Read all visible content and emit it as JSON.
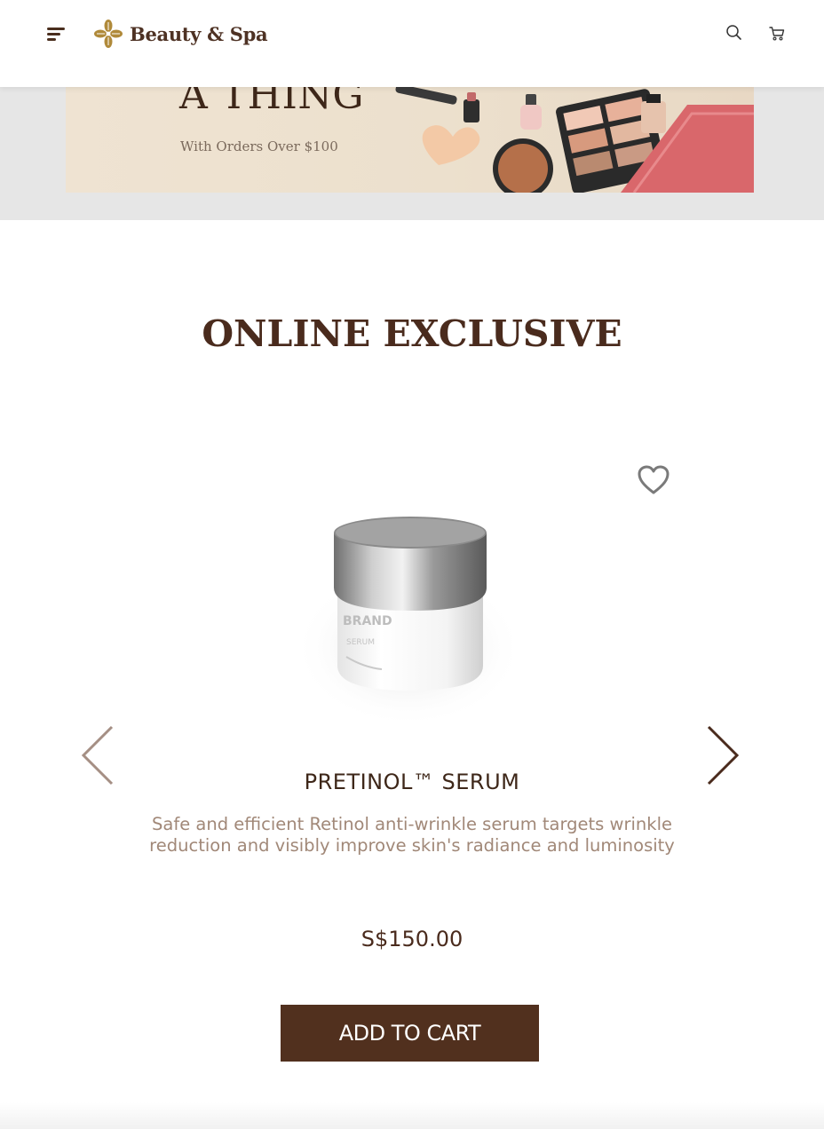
{
  "header": {
    "logo_text": "Beauty & Spa",
    "icons": [
      "menu-icon",
      "search-icon",
      "cart-icon"
    ]
  },
  "banner": {
    "headline": "A THING",
    "subtext": "With Orders Over $100"
  },
  "section": {
    "title": "ONLINE EXCLUSIVE"
  },
  "product": {
    "name": "PRETINOL™ SERUM",
    "description": "Safe and efficient Retinol anti-wrinkle serum targets wrinkle reduction and visibly improve skin's radiance and luminosity",
    "price": "S$150.00",
    "add_to_cart_label": "ADD TO CART",
    "jar_label": "BRAND",
    "jar_sublabel": "SERUM"
  },
  "colors": {
    "brand_brown": "#51301e",
    "gold": "#b08a3a",
    "muted_text": "#a18878"
  }
}
